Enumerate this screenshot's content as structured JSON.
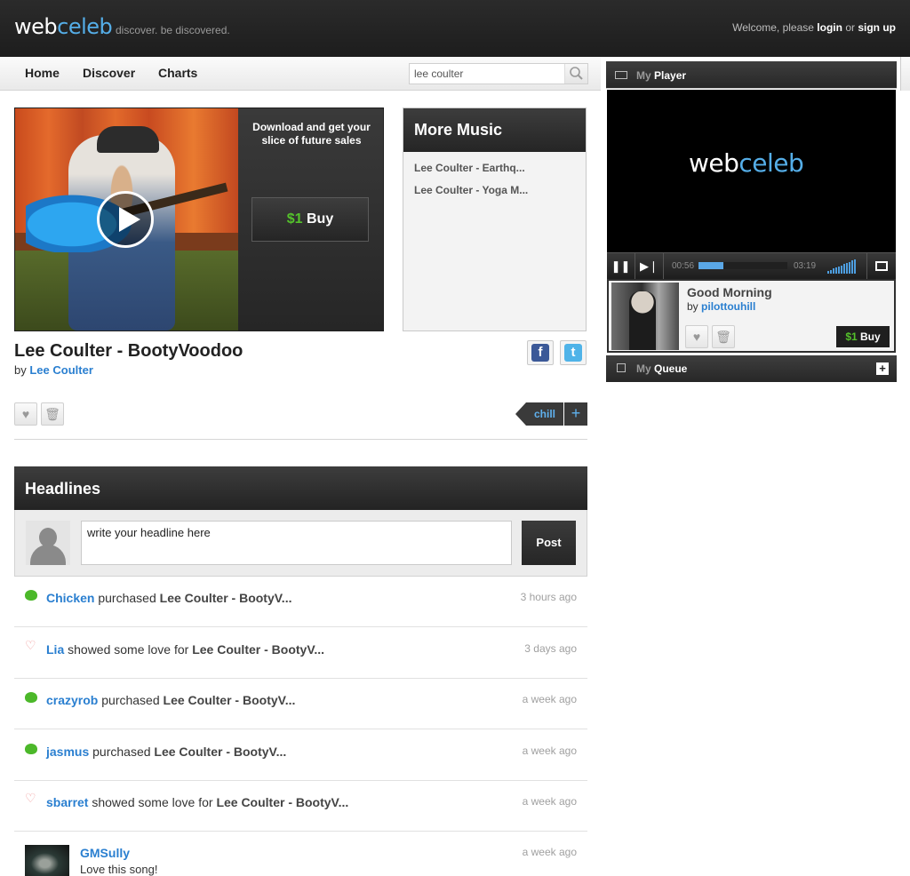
{
  "brand": {
    "logo_part1": "web",
    "logo_part2": "celeb",
    "tagline": "discover. be discovered."
  },
  "header": {
    "welcome_prefix": "Welcome, please",
    "login": "login",
    "or": "or",
    "signup": "sign up"
  },
  "nav": {
    "items": [
      "Home",
      "Discover",
      "Charts"
    ]
  },
  "search": {
    "value": "lee coulter",
    "icon": "search-icon"
  },
  "hero": {
    "download_text": "Download and get your slice of future sales",
    "buy_price": "$1",
    "buy_label": "Buy"
  },
  "more_music": {
    "title": "More Music",
    "items": [
      "Lee Coulter - Earthq...",
      "Lee Coulter - Yoga M..."
    ]
  },
  "song": {
    "title": "Lee Coulter - BootyVoodoo",
    "by": "by",
    "artist": "Lee Coulter"
  },
  "tags": {
    "tag": "chill",
    "add": "+"
  },
  "headlines": {
    "title": "Headlines",
    "input_value": "write your headline here",
    "post_label": "Post"
  },
  "feed": [
    {
      "icon": "money-icon",
      "user": "Chicken",
      "action": "purchased",
      "song": "Lee Coulter - BootyV...",
      "time": "3 hours ago"
    },
    {
      "icon": "heart-icon",
      "user": "Lia",
      "action": "showed some love for",
      "song": "Lee Coulter - BootyV...",
      "time": "3 days ago"
    },
    {
      "icon": "money-icon",
      "user": "crazyrob",
      "action": "purchased",
      "song": "Lee Coulter - BootyV...",
      "time": "a week ago"
    },
    {
      "icon": "money-icon",
      "user": "jasmus",
      "action": "purchased",
      "song": "Lee Coulter - BootyV...",
      "time": "a week ago"
    },
    {
      "icon": "heart-icon",
      "user": "sbarret",
      "action": "showed some love for",
      "song": "Lee Coulter - BootyV...",
      "time": "a week ago"
    }
  ],
  "comment": {
    "user": "GMSully",
    "text": "Love this song!",
    "time": "a week ago"
  },
  "player": {
    "title_dim": "My",
    "title": "Player",
    "screen_logo_part1": "web",
    "screen_logo_part2": "celeb",
    "elapsed": "00:56",
    "duration": "03:19",
    "progress": 0.28,
    "now_playing": {
      "title": "Good Morning",
      "by": "by",
      "artist": "pilottouhill",
      "buy_price": "$1",
      "buy_label": "Buy"
    }
  },
  "queue": {
    "title_dim": "My",
    "title": "Queue"
  },
  "colors": {
    "accent_blue": "#2a7fd0",
    "price_green": "#54c22b",
    "dark_header": "#2b2b2b"
  }
}
